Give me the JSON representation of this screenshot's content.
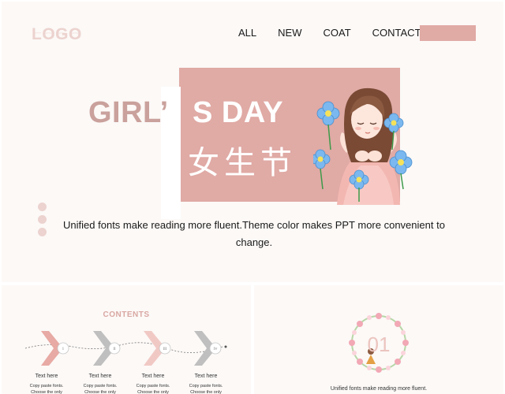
{
  "header": {
    "logo": "LOGO",
    "nav": [
      "ALL",
      "NEW",
      "COAT",
      "CONTACT"
    ]
  },
  "hero": {
    "title_part1": "GIRL’",
    "title_part2": "S DAY",
    "title_cn": "女生节",
    "body": "Unified fonts make reading more fluent.Theme color makes PPT more convenient to change."
  },
  "contents": {
    "title": "CONTENTS",
    "steps": [
      {
        "num": "i",
        "label": "Text here",
        "desc": "Copy paste fonts.\nChoose the only"
      },
      {
        "num": "ii",
        "label": "Text here",
        "desc": "Copy paste fonts.\nChoose the only"
      },
      {
        "num": "iii",
        "label": "Text here",
        "desc": "Copy paste fonts.\nChoose the only"
      },
      {
        "num": "iv",
        "label": "Text here",
        "desc": "Copy paste fonts.\nChoose the only"
      }
    ]
  },
  "section": {
    "number": "01",
    "text": "Unified fonts make reading more fluent."
  },
  "colors": {
    "accent": "#e0aaa5",
    "light_pink": "#ecd3cf",
    "background": "#fcf9f7"
  }
}
